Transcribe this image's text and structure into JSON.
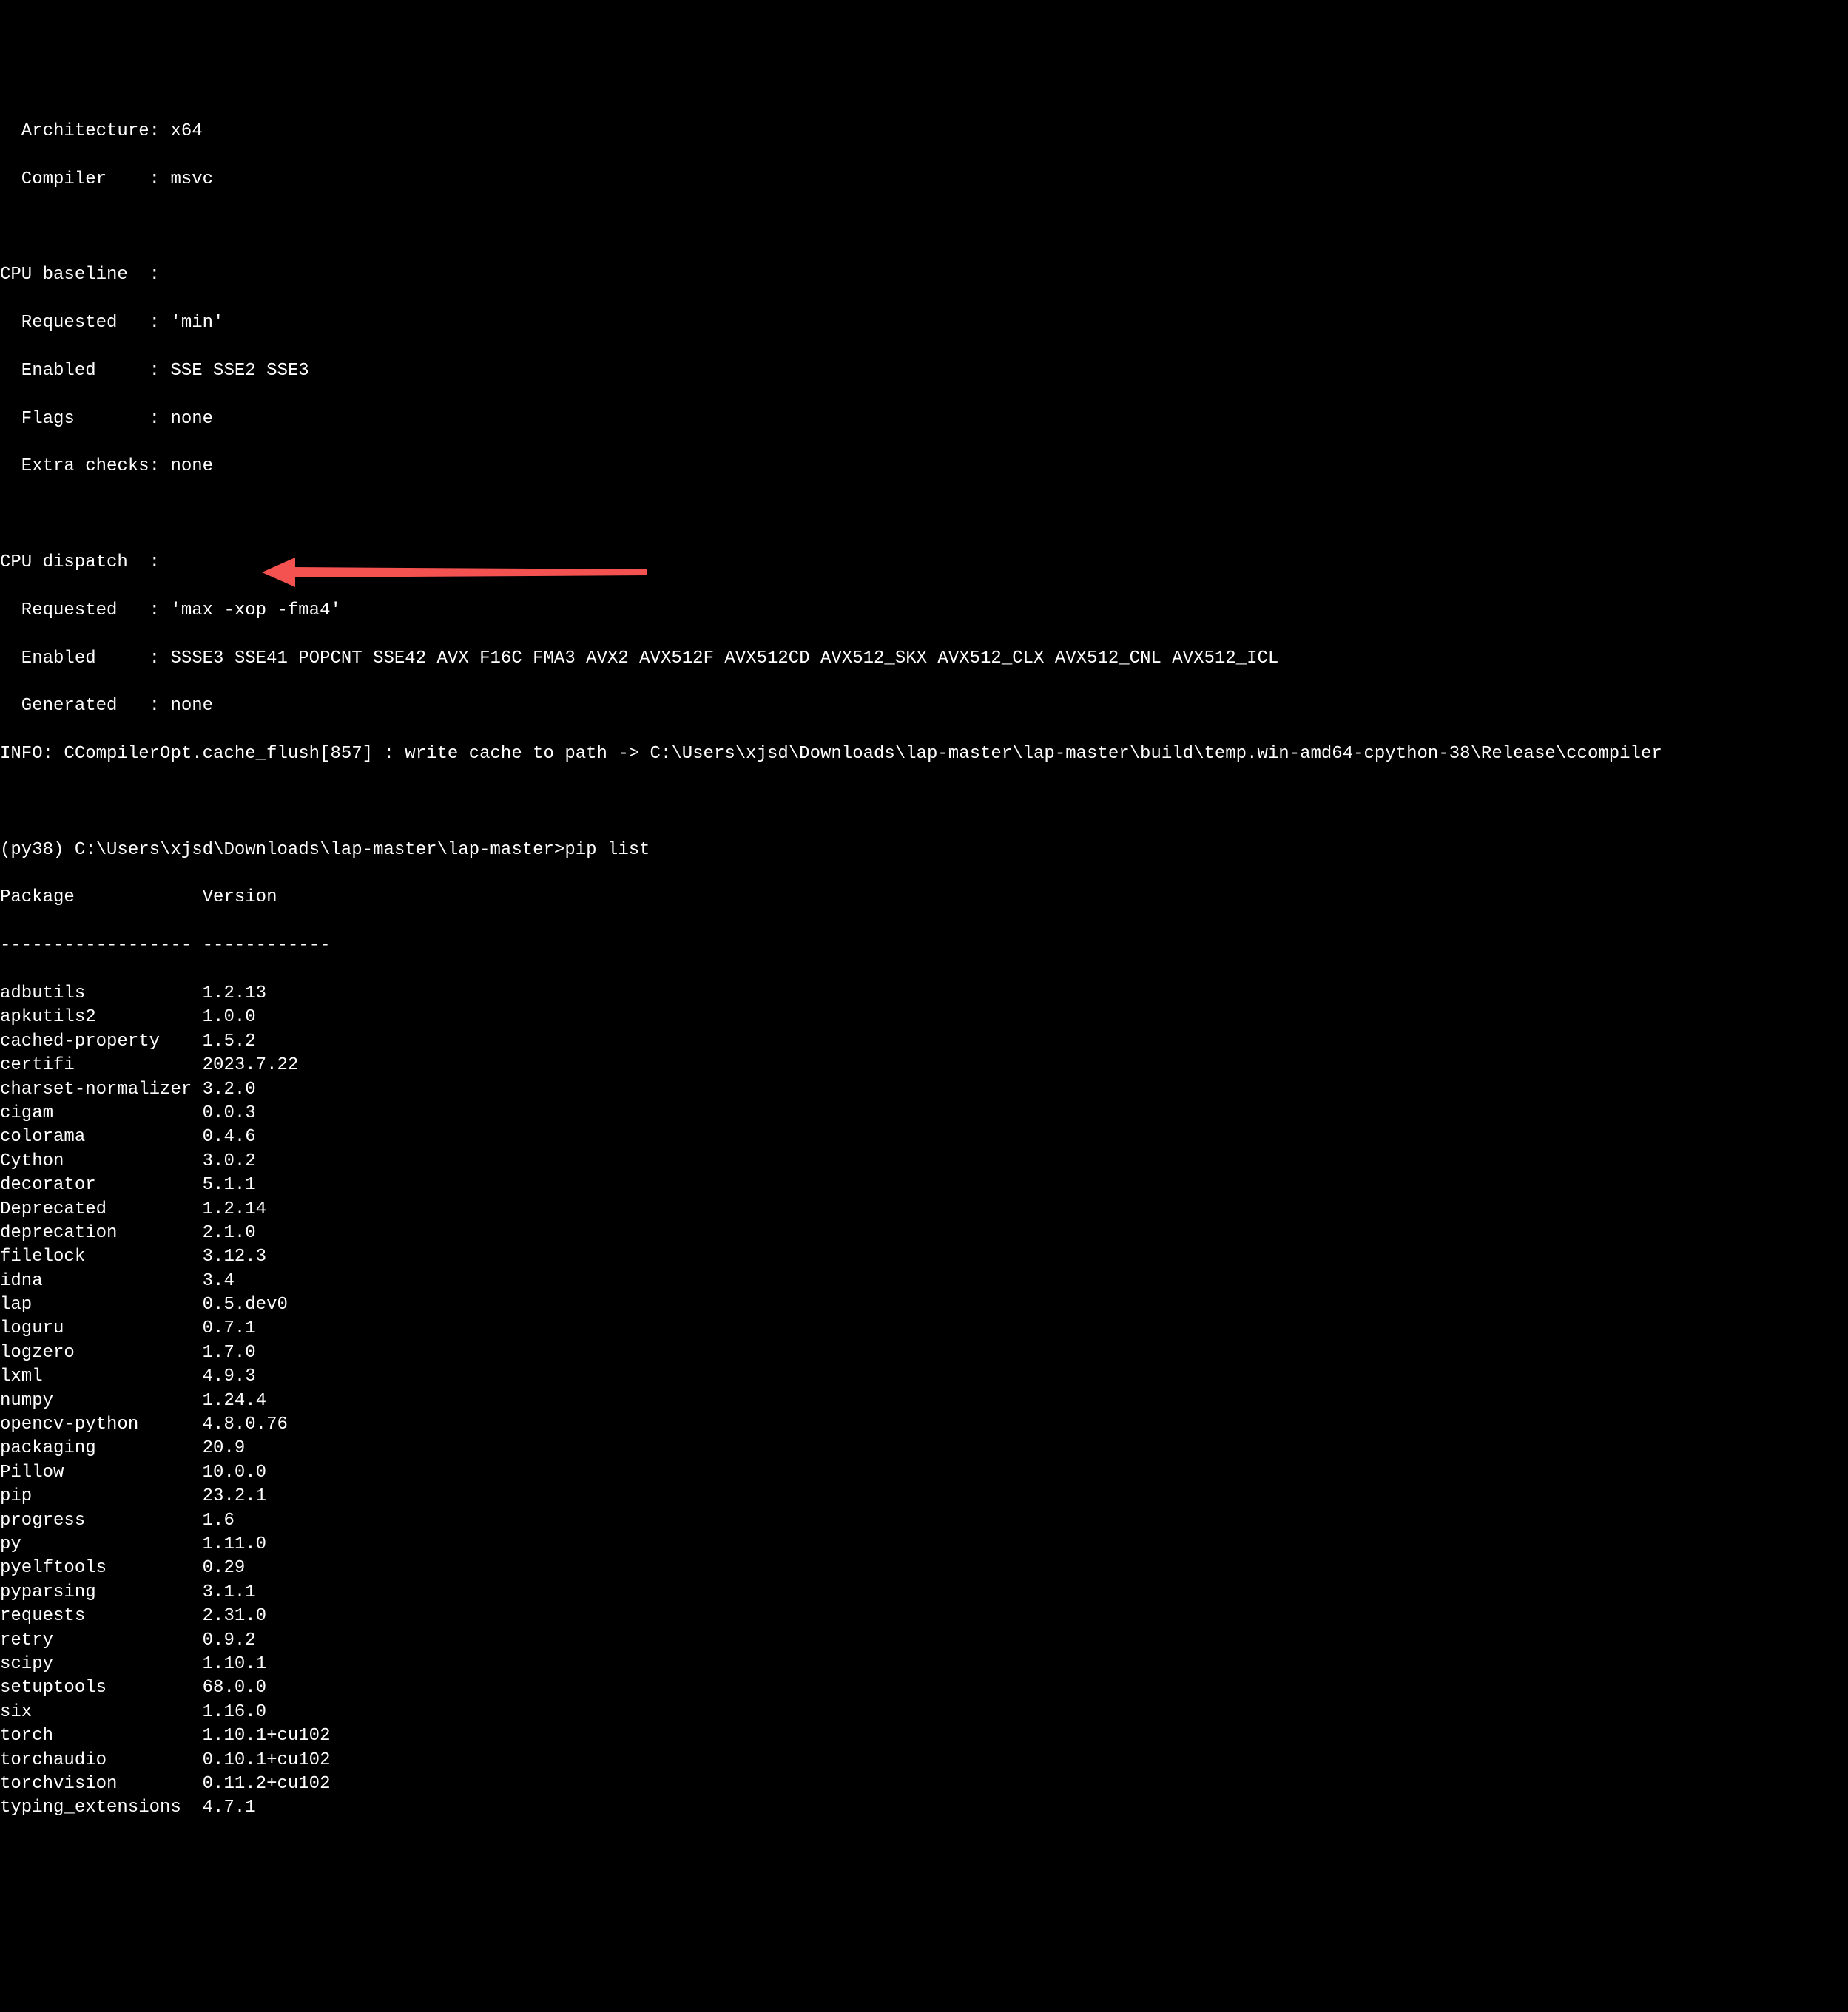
{
  "header": {
    "arch_label": "  Architecture:",
    "arch_value": " x64",
    "compiler_label": "  Compiler    :",
    "compiler_value": " msvc",
    "baseline_label": "CPU baseline  :",
    "baseline_req_label": "  Requested   :",
    "baseline_req_value": " 'min'",
    "baseline_enabled_label": "  Enabled     :",
    "baseline_enabled_value": " SSE SSE2 SSE3",
    "baseline_flags_label": "  Flags       :",
    "baseline_flags_value": " none",
    "baseline_extra_label": "  Extra checks:",
    "baseline_extra_value": " none",
    "dispatch_label": "CPU dispatch  :",
    "dispatch_req_label": "  Requested   :",
    "dispatch_req_value": " 'max -xop -fma4'",
    "dispatch_enabled_label": "  Enabled     :",
    "dispatch_enabled_value": " SSSE3 SSE41 POPCNT SSE42 AVX F16C FMA3 AVX2 AVX512F AVX512CD AVX512_SKX AVX512_CLX AVX512_CNL AVX512_ICL",
    "dispatch_gen_label": "  Generated   :",
    "dispatch_gen_value": " none",
    "info_line": "INFO: CCompilerOpt.cache_flush[857] : write cache to path -> C:\\Users\\xjsd\\Downloads\\lap-master\\lap-master\\build\\temp.win-amd64-cpython-38\\Release\\ccompiler"
  },
  "prompt": {
    "line": "(py38) C:\\Users\\xjsd\\Downloads\\lap-master\\lap-master>pip list"
  },
  "table": {
    "header_pkg": "Package           ",
    "header_ver": " Version",
    "divider": "------------------ ------------"
  },
  "packages": [
    {
      "name": "adbutils          ",
      "version": " 1.2.13"
    },
    {
      "name": "apkutils2         ",
      "version": " 1.0.0"
    },
    {
      "name": "cached-property   ",
      "version": " 1.5.2"
    },
    {
      "name": "certifi           ",
      "version": " 2023.7.22"
    },
    {
      "name": "charset-normalizer",
      "version": " 3.2.0"
    },
    {
      "name": "cigam             ",
      "version": " 0.0.3"
    },
    {
      "name": "colorama          ",
      "version": " 0.4.6"
    },
    {
      "name": "Cython            ",
      "version": " 3.0.2"
    },
    {
      "name": "decorator         ",
      "version": " 5.1.1"
    },
    {
      "name": "Deprecated        ",
      "version": " 1.2.14"
    },
    {
      "name": "deprecation       ",
      "version": " 2.1.0"
    },
    {
      "name": "filelock          ",
      "version": " 3.12.3"
    },
    {
      "name": "idna              ",
      "version": " 3.4"
    },
    {
      "name": "lap               ",
      "version": " 0.5.dev0"
    },
    {
      "name": "loguru            ",
      "version": " 0.7.1"
    },
    {
      "name": "logzero           ",
      "version": " 1.7.0"
    },
    {
      "name": "lxml              ",
      "version": " 4.9.3"
    },
    {
      "name": "numpy             ",
      "version": " 1.24.4"
    },
    {
      "name": "opencv-python     ",
      "version": " 4.8.0.76"
    },
    {
      "name": "packaging         ",
      "version": " 20.9"
    },
    {
      "name": "Pillow            ",
      "version": " 10.0.0"
    },
    {
      "name": "pip               ",
      "version": " 23.2.1"
    },
    {
      "name": "progress          ",
      "version": " 1.6"
    },
    {
      "name": "py                ",
      "version": " 1.11.0"
    },
    {
      "name": "pyelftools        ",
      "version": " 0.29"
    },
    {
      "name": "pyparsing         ",
      "version": " 3.1.1"
    },
    {
      "name": "requests          ",
      "version": " 2.31.0"
    },
    {
      "name": "retry             ",
      "version": " 0.9.2"
    },
    {
      "name": "scipy             ",
      "version": " 1.10.1"
    },
    {
      "name": "setuptools        ",
      "version": " 68.0.0"
    },
    {
      "name": "six               ",
      "version": " 1.16.0"
    },
    {
      "name": "torch             ",
      "version": " 1.10.1+cu102"
    },
    {
      "name": "torchaudio        ",
      "version": " 0.10.1+cu102"
    },
    {
      "name": "torchvision       ",
      "version": " 0.11.2+cu102"
    },
    {
      "name": "typing_extensions ",
      "version": " 4.7.1"
    }
  ],
  "arrow": {
    "color": "#f45151"
  }
}
